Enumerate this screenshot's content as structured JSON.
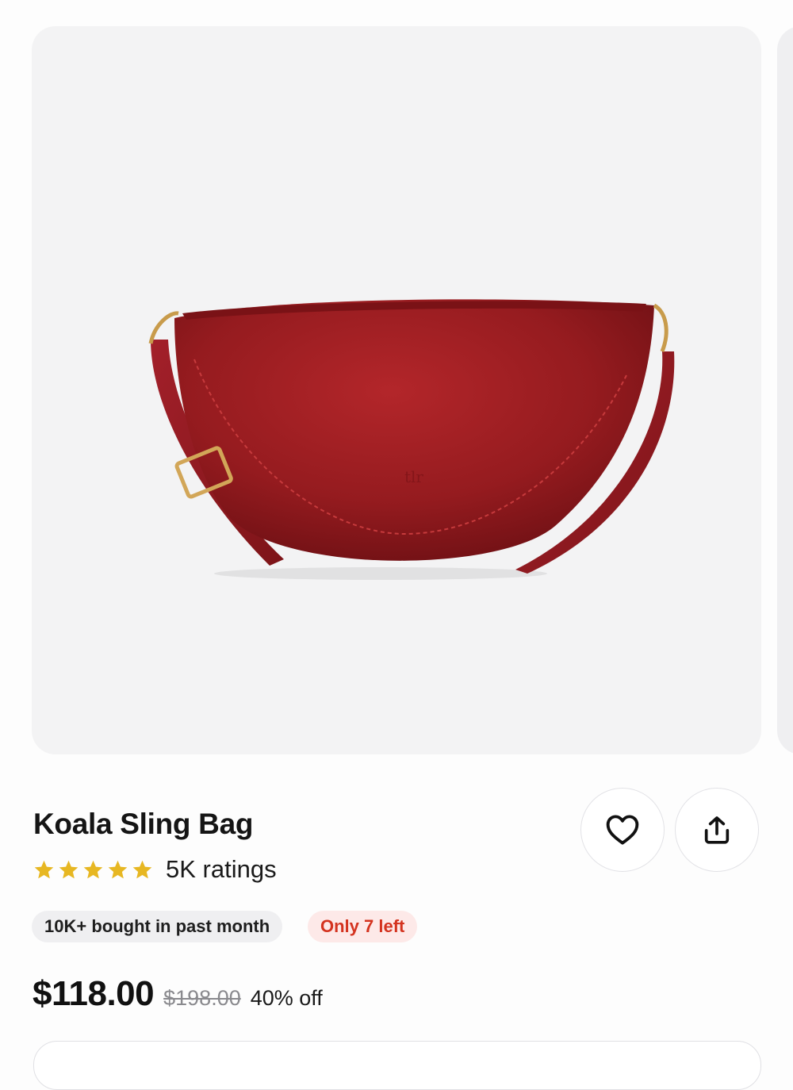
{
  "product": {
    "title": "Koala Sling Bag",
    "image_alt": "red leather sling bag",
    "rating_stars": 5,
    "ratings_label": "5K ratings",
    "bought_badge": "10K+ bought in past month",
    "stock_badge": "Only 7 left",
    "price": "$118.00",
    "original_price": "$198.00",
    "discount": "40% off"
  },
  "actions": {
    "favorite_icon": "heart-icon",
    "share_icon": "share-icon"
  },
  "colors": {
    "star": "#e7b722",
    "bag": "#9b1b1e",
    "stock_text": "#d4331f",
    "stock_bg": "#fde9e8"
  }
}
